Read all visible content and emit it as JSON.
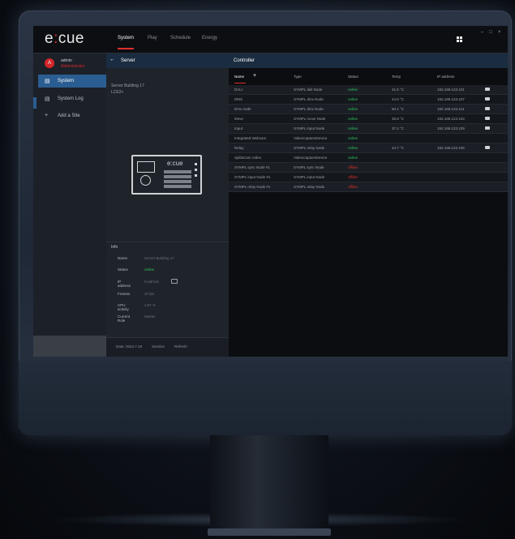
{
  "app": {
    "logo_pre": "e",
    "logo_x": ":",
    "logo_post": "cue"
  },
  "nav": {
    "items": [
      "System",
      "Play",
      "Schedule",
      "Energy"
    ]
  },
  "window": {
    "minimize": "–",
    "maximize": "□",
    "close": "×"
  },
  "user": {
    "initial": "A",
    "name": "admin",
    "role": "Administrator"
  },
  "sidebar": {
    "items": [
      {
        "icon": "▤",
        "label": "System"
      },
      {
        "icon": "▤",
        "label": "System Log"
      },
      {
        "icon": "+",
        "label": "Add a Site"
      }
    ]
  },
  "server": {
    "back_icon": "←",
    "title": "Server",
    "name": "Server Building 17",
    "model": "LCE2+",
    "device_brand": "e:cue"
  },
  "info": {
    "title": "Info",
    "rows": [
      {
        "key": "Name",
        "value": "Server Building 17"
      },
      {
        "key": "Status",
        "value": "online"
      },
      {
        "key": "IP address",
        "value": "localhost"
      },
      {
        "key": "Frames",
        "value": "30 fps"
      },
      {
        "key": "CPU activity",
        "value": "2.87 %"
      },
      {
        "key": "Current Role",
        "value": "Master"
      }
    ]
  },
  "footer": {
    "date": "Date: 2024.7.19",
    "session": "Session",
    "refresh": "Refresh"
  },
  "controller": {
    "title": "Controller",
    "add_icon": "+",
    "columns": [
      "Name",
      "Type",
      "Status",
      "Temp",
      "IP address"
    ],
    "rows": [
      {
        "name": "DALI",
        "type": "SYMPL dali Node",
        "status": "online",
        "temp": "41.5 °C",
        "ip": "192.168.123.101",
        "chip": true
      },
      {
        "name": "DMX",
        "type": "SYMPL dmx Node",
        "status": "online",
        "temp": "44.6 °C",
        "ip": "192.168.123.107",
        "chip": true
      },
      {
        "name": "Dmx node",
        "type": "SYMPL dmx Node",
        "status": "online",
        "temp": "50.1 °C",
        "ip": "192.168.123.114",
        "chip": true
      },
      {
        "name": "Move",
        "type": "SYMPL move Node",
        "status": "online",
        "temp": "35.8 °C",
        "ip": "192.168.123.103",
        "chip": true
      },
      {
        "name": "Input",
        "type": "SYMPL input Node",
        "status": "online",
        "temp": "37.4 °C",
        "ip": "192.168.123.109",
        "chip": true
      },
      {
        "name": "Integrated Webcam",
        "type": "VideoCaptureDevice",
        "status": "online",
        "temp": "",
        "ip": "",
        "chip": false
      },
      {
        "name": "Relay",
        "type": "SYMPL relay Node",
        "status": "online",
        "temp": "44.7 °C",
        "ip": "192.168.123.105",
        "chip": true
      },
      {
        "name": "SplitsCam Video",
        "type": "VideoCaptureDevice",
        "status": "online",
        "temp": "",
        "ip": "",
        "chip": false
      },
      {
        "name": "SYMPL sync Node #1",
        "type": "SYMPL sync Node",
        "status": "offline",
        "temp": "",
        "ip": "",
        "chip": false
      },
      {
        "name": "SYMPL input Node #1",
        "type": "SYMPL input Node",
        "status": "offline",
        "temp": "",
        "ip": "",
        "chip": false
      },
      {
        "name": "SYMPL relay Node #1",
        "type": "SYMPL relay Node",
        "status": "offline",
        "temp": "",
        "ip": "",
        "chip": false
      }
    ]
  },
  "colors": {
    "accent": "#e0302a",
    "selected": "#2a5d91",
    "online": "#2ec35a",
    "offline": "#e0302a"
  }
}
